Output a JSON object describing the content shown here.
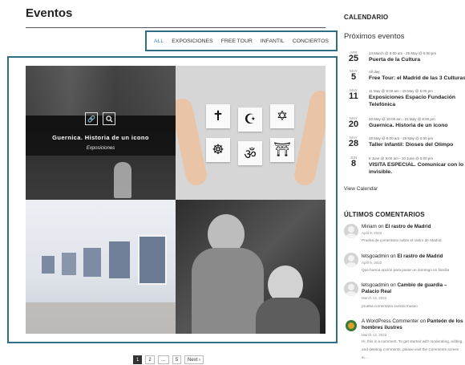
{
  "page": {
    "title": "Eventos"
  },
  "filters": [
    {
      "label": "ALL",
      "active": true
    },
    {
      "label": "EXPOSICIONES",
      "active": false
    },
    {
      "label": "FREE TOUR",
      "active": false
    },
    {
      "label": "INFANTIL",
      "active": false
    },
    {
      "label": "CONCIERTOS",
      "active": false
    }
  ],
  "portfolio": {
    "hover_item": {
      "title": "Guernica. Historia de un icono",
      "category": "Exposiciones",
      "link_icon": "link-icon",
      "zoom_icon": "search-icon"
    },
    "symbols": [
      "✝",
      "☪",
      "✡",
      "☸",
      "ॐ",
      "⛩"
    ]
  },
  "pagination": {
    "pages": [
      "1",
      "2",
      "…",
      "5"
    ],
    "next": "Next ›",
    "current": "1"
  },
  "sidebar": {
    "calendar_heading": "CALENDARIO",
    "upcoming_heading": "Próximos eventos",
    "events": [
      {
        "month": "APR",
        "day": "25",
        "meta": "24 March @ 8:00 am - 26 May @ 5:00 pm",
        "title": "Puerta de la Cultura"
      },
      {
        "month": "MAY",
        "day": "5",
        "meta": "All day",
        "title": "Free Tour: el Madrid de las 3 Culturas"
      },
      {
        "month": "MAY",
        "day": "11",
        "meta": "11 May @ 8:00 am - 18 May @ 5:00 pm",
        "title": "Exposiciones Espacio Fundación Telefónica"
      },
      {
        "month": "MAY",
        "day": "20",
        "meta": "20 May @ 10:00 am - 22 May @ 8:00 pm",
        "title": "Guernica. Historia de un icono"
      },
      {
        "month": "MAY",
        "day": "28",
        "meta": "28 May @ 8:00 am - 29 May @ 5:00 pm",
        "title": "Taller infantil: Dioses del Olimpo"
      },
      {
        "month": "JUN",
        "day": "8",
        "meta": "8 June @ 8:00 am - 10 June @ 5:00 pm",
        "title": "VISITA ESPECIAL. Comunicar con lo invisible."
      }
    ],
    "view_calendar": "View Calendar",
    "comments_heading": "ÚLTIMOS COMENTARIOS",
    "comments": [
      {
        "author": "Miriam",
        "on": "on",
        "post": "El rastro de Madrid",
        "date": "April 9, 2022",
        "text": "Prueba de comentario sobre el rastro de Madrid."
      },
      {
        "author": "letsgoadmin",
        "on": "on",
        "post": "El rastro de Madrid",
        "date": "April 9, 2022",
        "text": "Que buena opción para pasar un domingo en familia"
      },
      {
        "author": "letsgoadmin",
        "on": "on",
        "post": "Cambio de guardia – Palacio Real",
        "date": "March 13, 2022",
        "text": "prueba comentario evento museo"
      },
      {
        "author": "A WordPress Commenter",
        "on": "on",
        "post": "Panteón de los hombres ilustres",
        "date": "March 13, 2022",
        "text": "Hi, this is a comment. To get started with moderating, editing, and deleting comments, please visit the Comments screen in…"
      }
    ]
  }
}
